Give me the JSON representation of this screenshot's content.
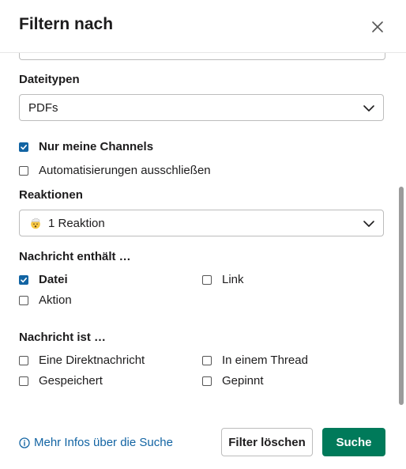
{
  "header": {
    "title": "Filtern nach",
    "close_icon": "close-icon"
  },
  "filetypes": {
    "label": "Dateitypen",
    "selected": "PDFs"
  },
  "options": {
    "only_my_channels": {
      "label": "Nur meine Channels",
      "checked": true
    },
    "exclude_automations": {
      "label": "Automatisierungen ausschließen",
      "checked": false
    }
  },
  "reactions": {
    "label": "Reaktionen",
    "selected": "1 Reaktion",
    "emoji_icon": "exploding-head-emoji"
  },
  "message_contains": {
    "label": "Nachricht enthält …",
    "items": [
      {
        "label": "Datei",
        "checked": true
      },
      {
        "label": "Link",
        "checked": false
      },
      {
        "label": "Aktion",
        "checked": false
      }
    ]
  },
  "message_is": {
    "label": "Nachricht ist …",
    "items": [
      {
        "label": "Eine Direktnachricht",
        "checked": false
      },
      {
        "label": "In einem Thread",
        "checked": false
      },
      {
        "label": "Gespeichert",
        "checked": false
      },
      {
        "label": "Gepinnt",
        "checked": false
      }
    ]
  },
  "footer": {
    "info_link": "Mehr Infos über die Suche",
    "clear_button": "Filter löschen",
    "search_button": "Suche"
  },
  "colors": {
    "primary": "#007a5a",
    "link": "#1264a3",
    "checkbox_checked": "#1264a3"
  }
}
